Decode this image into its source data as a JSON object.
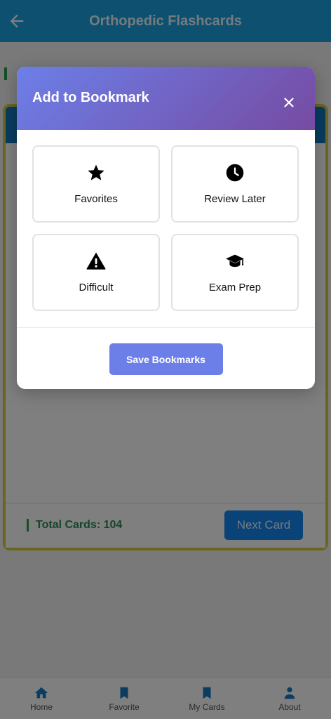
{
  "app": {
    "title": "Orthopedic Flashcards",
    "total_cards": "Total Cards: 104",
    "next_label": "Next Card"
  },
  "bottom_nav": {
    "items": [
      {
        "label": "Home",
        "icon": "home-icon"
      },
      {
        "label": "Favorite",
        "icon": "bookmark-icon"
      },
      {
        "label": "My Cards",
        "icon": "bookmark-icon"
      },
      {
        "label": "About",
        "icon": "person-icon"
      }
    ]
  },
  "modal": {
    "title": "Add to Bookmark",
    "close_icon": "close-icon",
    "options": [
      {
        "label": "Favorites",
        "icon": "star-icon"
      },
      {
        "label": "Review Later",
        "icon": "clock-icon"
      },
      {
        "label": "Difficult",
        "icon": "warning-icon"
      },
      {
        "label": "Exam Prep",
        "icon": "graduation-cap-icon"
      }
    ],
    "save_label": "Save Bookmarks"
  },
  "colors": {
    "header_gradient_start": "#6c7fe8",
    "header_gradient_end": "#764ba2",
    "save_button": "#6c7fe8",
    "app_bar": "#1aa0e0",
    "card_border": "#d8cc3a"
  }
}
